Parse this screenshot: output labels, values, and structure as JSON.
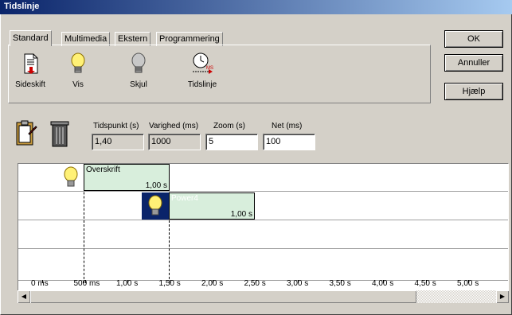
{
  "window": {
    "title": "Tidslinje"
  },
  "tabs": [
    {
      "label": "Standard",
      "active": true
    },
    {
      "label": "Multimedia",
      "active": false
    },
    {
      "label": "Ekstern",
      "active": false
    },
    {
      "label": "Programmering",
      "active": false
    }
  ],
  "tools": [
    {
      "label": "Sideskift",
      "icon": "page-break-icon"
    },
    {
      "label": "Vis",
      "icon": "lightbulb-on-icon"
    },
    {
      "label": "Skjul",
      "icon": "lightbulb-off-icon"
    },
    {
      "label": "Tidslinje",
      "icon": "clock-timeline-icon"
    }
  ],
  "buttons": {
    "ok": "OK",
    "cancel": "Annuller",
    "help": "Hjælp"
  },
  "fields": {
    "time_label": "Tidspunkt (s)",
    "time_value": "1,40",
    "duration_label": "Varighed (ms)",
    "duration_value": "1000",
    "zoom_label": "Zoom (s)",
    "zoom_value": "5",
    "net_label": "Net (ms)",
    "net_value": "100"
  },
  "timeline": {
    "items": [
      {
        "name": "Overskrift",
        "duration": "1,00 s"
      },
      {
        "name": "Power4",
        "duration": "1,00 s"
      }
    ],
    "ticks": [
      "0 ms",
      "500 ms",
      "1,00 s",
      "1,50 s",
      "2,00 s",
      "2,50 s",
      "3,00 s",
      "3,50 s",
      "4,00 s",
      "4,50 s",
      "5,00 s"
    ]
  }
}
